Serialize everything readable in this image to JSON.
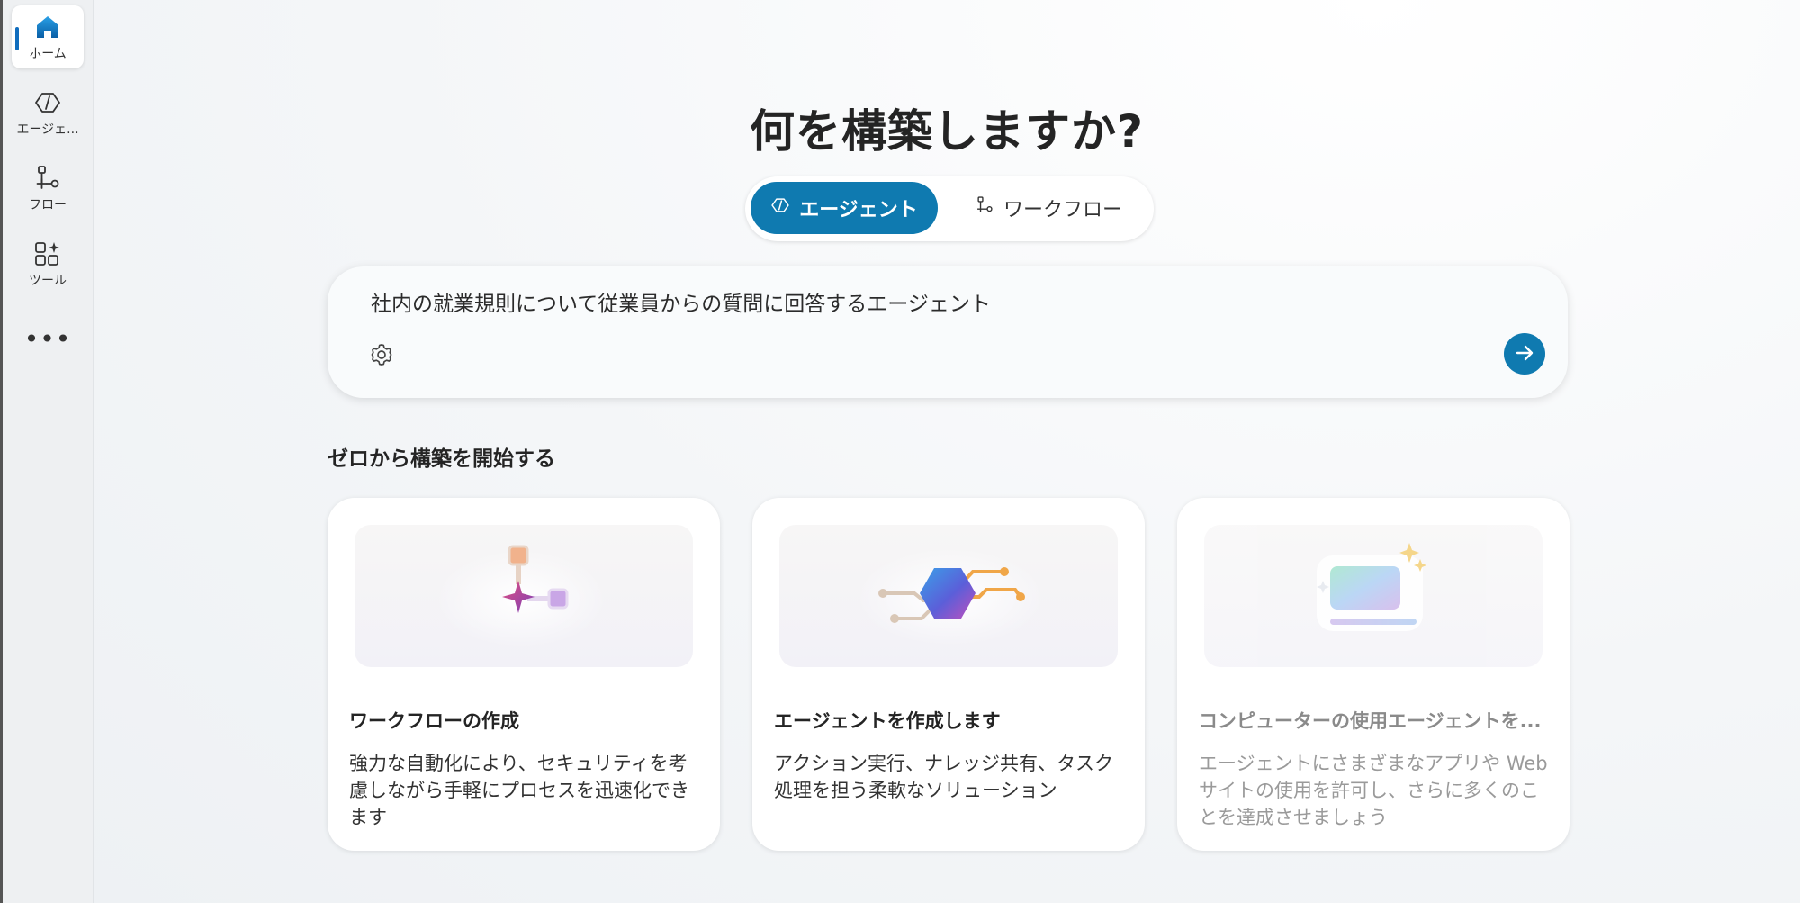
{
  "sidebar": {
    "items": [
      {
        "label": "ホーム",
        "icon": "home-icon",
        "active": true
      },
      {
        "label": "エージェ...",
        "icon": "agent-icon",
        "active": false
      },
      {
        "label": "フロー",
        "icon": "flow-icon",
        "active": false
      },
      {
        "label": "ツール",
        "icon": "tools-icon",
        "active": false
      }
    ],
    "more_label": "•••"
  },
  "main": {
    "title": "何を構築しますか?",
    "modes": [
      {
        "label": "エージェント",
        "icon": "agent-icon",
        "selected": true
      },
      {
        "label": "ワークフロー",
        "icon": "workflow-icon",
        "selected": false
      }
    ],
    "prompt": {
      "value": "社内の就業規則について従業員からの質問に回答するエージェント",
      "settings_icon": "gear-icon",
      "send_icon": "arrow-right-icon"
    },
    "section_heading": "ゼロから構築を開始する",
    "cards": [
      {
        "title": "ワークフローの作成",
        "description": "強力な自動化により、セキュリティを考慮しながら手軽にプロセスを迅速化できます",
        "icon": "workflow-illustration",
        "disabled": false
      },
      {
        "title": "エージェントを作成します",
        "description": "アクション実行、ナレッジ共有、タスク処理を担う柔軟なソリューション",
        "icon": "agent-illustration",
        "disabled": false
      },
      {
        "title": "コンピューターの使用エージェントを...",
        "description": "エージェントにさまざまなアプリや Web サイトの使用を許可し、さらに多くのことを達成させましょう",
        "icon": "computer-use-illustration",
        "disabled": true
      }
    ]
  },
  "colors": {
    "accent": "#0f7ab0",
    "nav_indicator": "#0f6cbd",
    "sidebar_bg": "#eef0f2"
  }
}
